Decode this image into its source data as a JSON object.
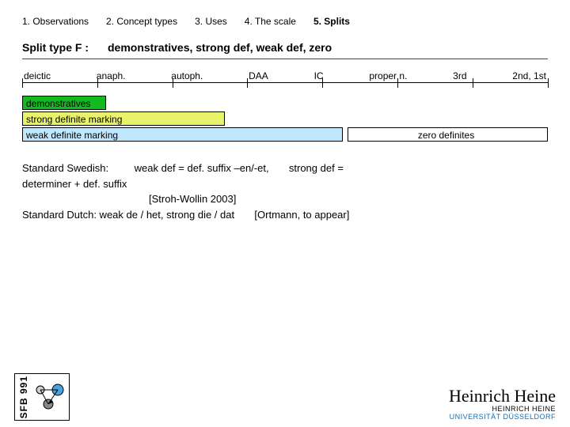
{
  "tabs": {
    "t1": "1. Observations",
    "t2": "2. Concept types",
    "t3": "3. Uses",
    "t4": "4. The scale",
    "t5": "5. Splits"
  },
  "title": {
    "heading": "Split type F :",
    "desc": "demonstratives, strong def, weak def, zero"
  },
  "scale_labels": {
    "l0": "deictic",
    "l1": "anaph.",
    "l2": "autoph.",
    "l3": "DAA",
    "l4": "IC",
    "l5": "proper n.",
    "l6": "3rd",
    "l7": "2nd, 1st"
  },
  "bars": {
    "demon": "demonstratives",
    "strong": "strong definite marking",
    "weak": "weak definite marking",
    "zero": "zero definites"
  },
  "body": {
    "line1a": "Standard Swedish:",
    "line1b": "weak def = def. suffix –en/-et,",
    "line1c": "strong def =",
    "line2": "determiner + def. suffix",
    "ref1": "[Stroh-Wollin 2003]",
    "line3a": "Standard Dutch:  weak de / het,  strong die / dat",
    "ref2": "[Ortmann, to appear]"
  },
  "footer": {
    "sfb": "SFB 991",
    "hhu_name": "Heinrich Heine",
    "hhu_line2": "HEINRICH HEINE",
    "hhu_uni": "UNIVERSITÄT DÜSSELDORF"
  },
  "chart_data": {
    "type": "bar",
    "title": "Split type F : demonstratives, strong def, weak def, zero",
    "categories": [
      "deictic",
      "anaph.",
      "autoph.",
      "DAA",
      "IC",
      "proper n.",
      "3rd",
      "2nd, 1st"
    ],
    "series": [
      {
        "name": "demonstratives",
        "covers": [
          "deictic"
        ]
      },
      {
        "name": "strong definite marking",
        "covers": [
          "deictic",
          "anaph.",
          "autoph."
        ]
      },
      {
        "name": "weak definite marking",
        "covers": [
          "deictic",
          "anaph.",
          "autoph.",
          "DAA",
          "IC"
        ]
      },
      {
        "name": "zero definites",
        "covers": [
          "proper n.",
          "3rd",
          "2nd, 1st"
        ]
      }
    ],
    "xlabel": "",
    "ylabel": "",
    "ylim": [
      0,
      1
    ]
  }
}
